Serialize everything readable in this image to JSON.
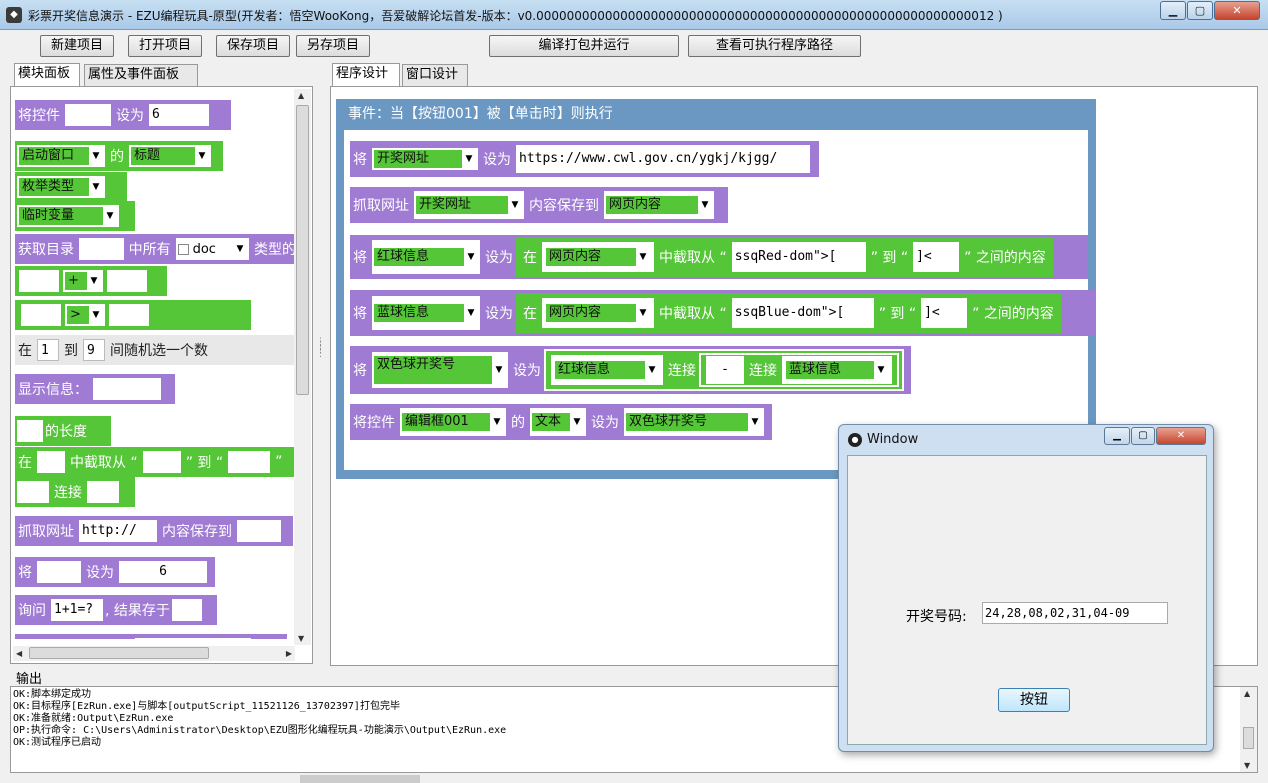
{
  "window": {
    "title": "彩票开奖信息演示 - EZU编程玩具-原型(开发者：悟空WooKong，吾爱破解论坛首发-版本：v0.000000000000000000000000000000000000000000000000000000000012 )",
    "minimize": "▁",
    "maximize": "▢",
    "close": "✕"
  },
  "toolbar": {
    "new_project": "新建项目",
    "open_project": "打开项目",
    "save_project": "保存项目",
    "save_as": "另存项目",
    "compile_run": "编译打包并运行",
    "view_exe_path": "查看可执行程序路径"
  },
  "left_tabs": {
    "modules": "模块面板",
    "properties": "属性及事件面板"
  },
  "right_tabs": {
    "program": "程序设计",
    "window": "窗口设计"
  },
  "left_blocks": {
    "b1": {
      "l1": "将控件",
      "l2": "设为",
      "v2": "6"
    },
    "b2": {
      "dd1": "启动窗口",
      "l1": "的",
      "dd2": "标题"
    },
    "b3": {
      "dd1": "枚举类型"
    },
    "b4": {
      "dd1": "临时变量"
    },
    "b5": {
      "l1": "获取目录",
      "l2": "中所有",
      "dd1": "doc",
      "l3": "类型的"
    },
    "b6": {
      "op": "+"
    },
    "b7": {
      "op": ">"
    },
    "b8": {
      "l1": "在",
      "v1": "1",
      "l2": "到",
      "v2": "9",
      "l3": "间随机选一个数"
    },
    "b9": {
      "l1": "显示信息："
    },
    "b10": {
      "l1": "的长度"
    },
    "b11": {
      "l1": "在",
      "l2": "中截取从 “",
      "l3": "” 到 “",
      "l4": "”"
    },
    "b12": {
      "l1": "连接"
    },
    "b13": {
      "l1": "抓取网址",
      "v1": "http://",
      "l2": "内容保存到"
    },
    "b14": {
      "l1": "将",
      "l2": "设为",
      "v2": "6"
    },
    "b15": {
      "l1": "询问",
      "v1": "1+1=?",
      "l2": ", 结果存于"
    }
  },
  "event": {
    "header": "事件：当【按钮001】被【单击时】则执行",
    "r1": {
      "l1": "将",
      "dd1": "开奖网址",
      "l2": "设为",
      "v1": "https://www.cwl.gov.cn/ygkj/kjgg/"
    },
    "r2": {
      "l1": "抓取网址",
      "dd1": "开奖网址",
      "l2": "内容保存到",
      "dd2": "网页内容"
    },
    "r3": {
      "l1": "将",
      "dd1": "红球信息",
      "l2": "设为",
      "l3": "在",
      "dd2": "网页内容",
      "l4": "中截取从 “",
      "v1": "ssqRed-dom\">[",
      "l5": "” 到 “",
      "v2": "]<",
      "l6": "” 之间的内容"
    },
    "r4": {
      "l1": "将",
      "dd1": "蓝球信息",
      "l2": "设为",
      "l3": "在",
      "dd2": "网页内容",
      "l4": "中截取从 “",
      "v1": "ssqBlue-dom\">[",
      "l5": "” 到 “",
      "v2": "]<",
      "l6": "” 之间的内容"
    },
    "r5": {
      "l1": "将",
      "dd1": "双色球开奖号",
      "l2": "设为",
      "dd2": "红球信息",
      "l3": "连接",
      "v1": "-",
      "l4": "连接",
      "dd3": "蓝球信息"
    },
    "r6": {
      "l1": "将控件",
      "dd1": "编辑框001",
      "l2": "的",
      "dd2": "文本",
      "l3": "设为",
      "dd3": "双色球开奖号"
    }
  },
  "output": {
    "label": "输出",
    "lines": [
      "OK:脚本绑定成功",
      "OK:目标程序[EzRun.exe]与脚本[outputScript_11521126_13702397]打包完毕",
      "OK:准备就绪:Output\\EzRun.exe",
      "OP:执行命令: C:\\Users\\Administrator\\Desktop\\EZU图形化编程玩具-功能演示\\Output\\EzRun.exe",
      "OK:测试程序已启动"
    ]
  },
  "popup": {
    "title": "Window",
    "label": "开奖号码:",
    "value": "24,28,08,02,31,04-09",
    "button": "按钮"
  },
  "colors": {
    "block_purple": "#a07bd3",
    "block_green": "#55c638",
    "event_blue": "#6b98c2"
  }
}
